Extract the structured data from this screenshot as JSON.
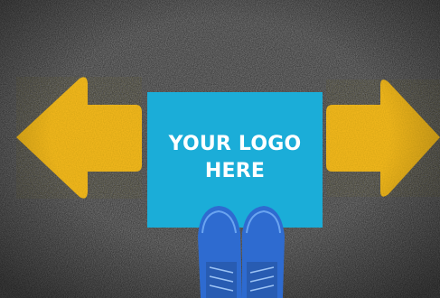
{
  "scene": {
    "ground": "asphalt",
    "left_arrow": {
      "direction": "left",
      "color": "#f0b61c"
    },
    "right_arrow": {
      "direction": "right",
      "color": "#f0b61c"
    },
    "logo_panel": {
      "text": "YOUR LOGO HERE",
      "color": "#1badd8",
      "text_color": "#ffffff"
    },
    "shoes": {
      "color": "#2f6fd1",
      "count": 2
    }
  }
}
